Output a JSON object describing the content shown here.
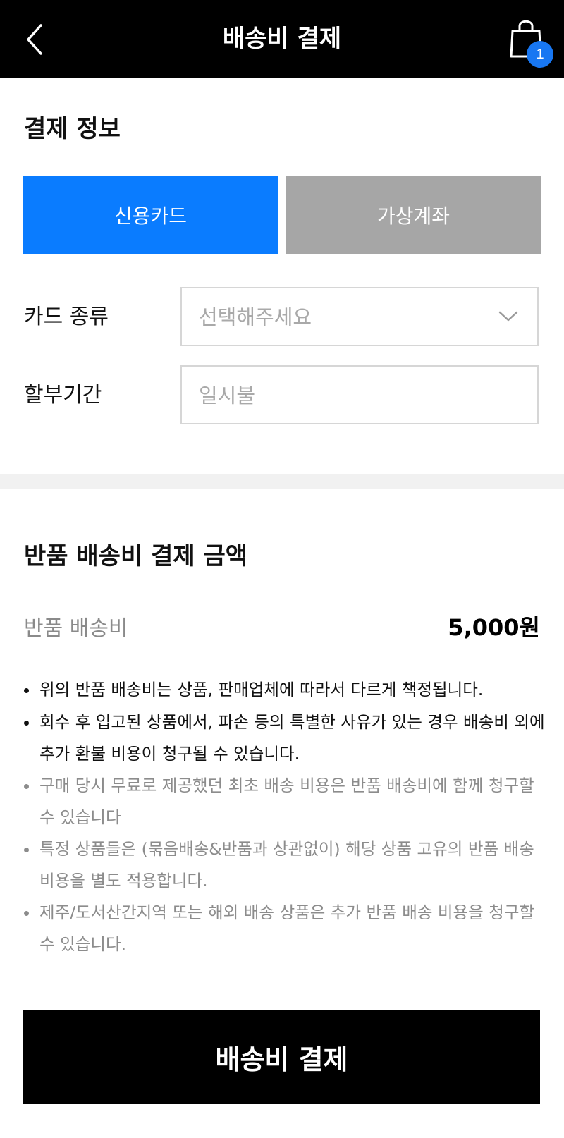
{
  "header": {
    "title": "배송비 결제",
    "back_icon": "chevron-left-icon",
    "cart_icon": "shopping-bag-icon",
    "cart_count": "1",
    "badge_color": "#1877f2"
  },
  "payment_info": {
    "title": "결제 정보",
    "tabs": [
      {
        "label": "신용카드",
        "selected": true,
        "color": "#0a7cff"
      },
      {
        "label": "가상계좌",
        "selected": false,
        "color": "#a6a6a6"
      }
    ],
    "card_type": {
      "label": "카드 종류",
      "placeholder": "선택해주세요"
    },
    "installment": {
      "label": "할부기간",
      "value": "일시불"
    }
  },
  "fee_section": {
    "title": "반품 배송비 결제 금액",
    "fee_label": "반품 배송비",
    "fee_value": "5,000원"
  },
  "notes": [
    {
      "text": "위의 반품 배송비는 상품, 판매업체에 따라서 다르게 책정됩니다.",
      "style": "dark"
    },
    {
      "text": "회수 후 입고된 상품에서, 파손 등의 특별한 사유가 있는 경우 배송비 외에 추가 환불 비용이 청구될 수 있습니다.",
      "style": "dark"
    },
    {
      "text": "구매 당시 무료로 제공했던 최초 배송 비용은 반품 배송비에 함께 청구할 수 있습니다",
      "style": "light"
    },
    {
      "text": "특정 상품들은 (묶음배송&반품과 상관없이) 해당 상품 고유의 반품 배송 비용을 별도 적용합니다.",
      "style": "light"
    },
    {
      "text": "제주/도서산간지역 또는 해외 배송 상품은 추가 반품 배송 비용을 청구할 수 있습니다.",
      "style": "light"
    }
  ],
  "submit": {
    "label": "배송비 결제"
  }
}
